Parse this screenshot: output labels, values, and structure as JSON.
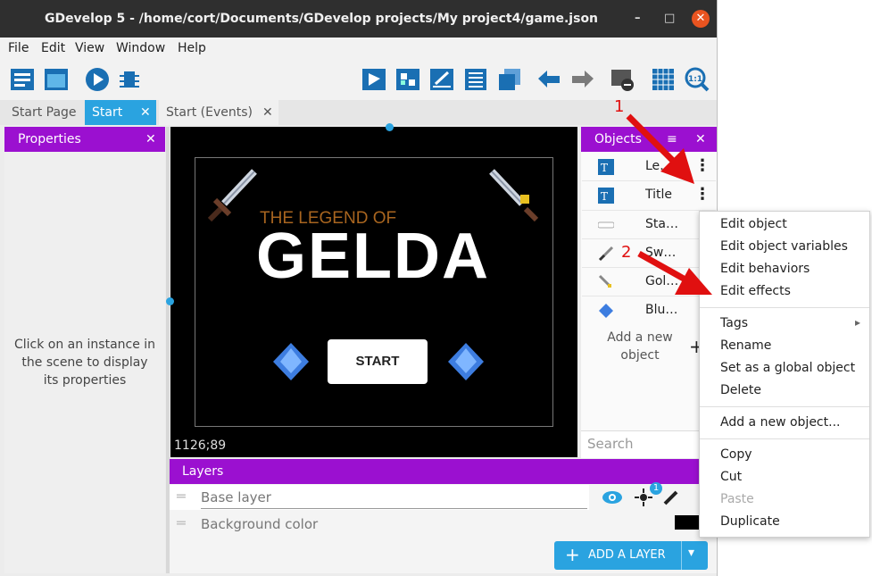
{
  "window": {
    "title": "GDevelop 5 - /home/cort/Documents/GDevelop projects/My project4/game.json",
    "controls": {
      "minimize": "–",
      "maximize": "□",
      "close": "✕"
    }
  },
  "menubar": [
    "File",
    "Edit",
    "View",
    "Window",
    "Help"
  ],
  "tabs": [
    {
      "label": "Start Page"
    },
    {
      "label": "Start",
      "close": "✕"
    },
    {
      "label": "Start (Events)",
      "close": "✕"
    }
  ],
  "properties": {
    "title": "Properties",
    "close": "✕",
    "hint": "Click on an instance in the scene to display its properties"
  },
  "scene": {
    "legend_text": "THE LEGEND OF",
    "game_title": "GELDA",
    "start_button": "START",
    "coords": "1126;89"
  },
  "objects": {
    "title": "Objects",
    "close": "✕",
    "items": [
      {
        "name": "Le…"
      },
      {
        "name": "Title"
      },
      {
        "name": "Sta…"
      },
      {
        "name": "Sw…"
      },
      {
        "name": "Gol…"
      },
      {
        "name": "Blu…"
      }
    ],
    "add_label": "Add a new object",
    "add_icon": "+",
    "search_placeholder": "Search"
  },
  "layers": {
    "title": "Layers",
    "items": [
      {
        "name": "Base layer"
      },
      {
        "name": "Background color"
      }
    ],
    "badge": "1",
    "add_button": "ADD A LAYER"
  },
  "context_menu": {
    "group1": [
      "Edit object",
      "Edit object variables",
      "Edit behaviors",
      "Edit effects"
    ],
    "group2": [
      "Tags",
      "Rename",
      "Set as a global object",
      "Delete"
    ],
    "group3": [
      "Add a new object..."
    ],
    "group4": [
      "Copy",
      "Cut",
      "Paste",
      "Duplicate"
    ],
    "tags_arrow": "▸"
  },
  "annotations": {
    "one": "1",
    "two": "2"
  },
  "colors": {
    "accent": "#9b10d0",
    "tab_active": "#2aa3e0",
    "annotation": "#e01010",
    "close_orange": "#e95420"
  }
}
